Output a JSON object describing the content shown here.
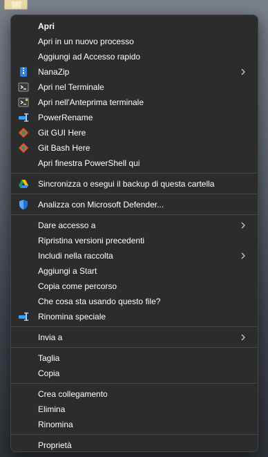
{
  "desktop": {
    "folder_icon": "folder-icon"
  },
  "menu": {
    "group1": [
      {
        "label": "Apri",
        "icon": ""
      },
      {
        "label": "Apri in un nuovo processo",
        "icon": ""
      },
      {
        "label": "Aggiungi ad Accesso rapido",
        "icon": ""
      },
      {
        "label": "NanaZip",
        "icon": "nanazip-icon",
        "submenu": true
      },
      {
        "label": "Apri nel Terminale",
        "icon": "terminal-icon"
      },
      {
        "label": "Apri nell'Anteprima terminale",
        "icon": "terminal-preview-icon"
      },
      {
        "label": "PowerRename",
        "icon": "powerrename-icon"
      },
      {
        "label": "Git GUI Here",
        "icon": "git-icon"
      },
      {
        "label": "Git Bash Here",
        "icon": "git-icon"
      },
      {
        "label": "Apri finestra PowerShell qui",
        "icon": ""
      }
    ],
    "group2": [
      {
        "label": "Sincronizza o esegui il backup di questa cartella",
        "icon": "google-drive-icon"
      }
    ],
    "group3": [
      {
        "label": "Analizza con Microsoft Defender...",
        "icon": "defender-shield-icon"
      }
    ],
    "group4": [
      {
        "label": "Dare accesso a",
        "icon": "",
        "submenu": true
      },
      {
        "label": "Ripristina versioni precedenti",
        "icon": ""
      },
      {
        "label": "Includi nella raccolta",
        "icon": "",
        "submenu": true
      },
      {
        "label": "Aggiungi a Start",
        "icon": ""
      },
      {
        "label": "Copia come percorso",
        "icon": ""
      },
      {
        "label": "Che cosa sta usando questo file?",
        "icon": ""
      },
      {
        "label": "Rinomina speciale",
        "icon": "powerrename-icon"
      }
    ],
    "group5": [
      {
        "label": "Invia a",
        "icon": "",
        "submenu": true
      }
    ],
    "group6": [
      {
        "label": "Taglia",
        "icon": ""
      },
      {
        "label": "Copia",
        "icon": ""
      }
    ],
    "group7": [
      {
        "label": "Crea collegamento",
        "icon": ""
      },
      {
        "label": "Elimina",
        "icon": ""
      },
      {
        "label": "Rinomina",
        "icon": ""
      }
    ],
    "group8": [
      {
        "label": "Proprietà",
        "icon": ""
      }
    ],
    "colors": {
      "menu_bg": "#2c2c2c",
      "separator": "#454545",
      "text": "#ffffff",
      "defender_blue": "#1a73d9",
      "git_orange": "#f05133",
      "nanazip_blue": "#2f7fe0",
      "powerrename_blue": "#3b9cf0"
    }
  }
}
